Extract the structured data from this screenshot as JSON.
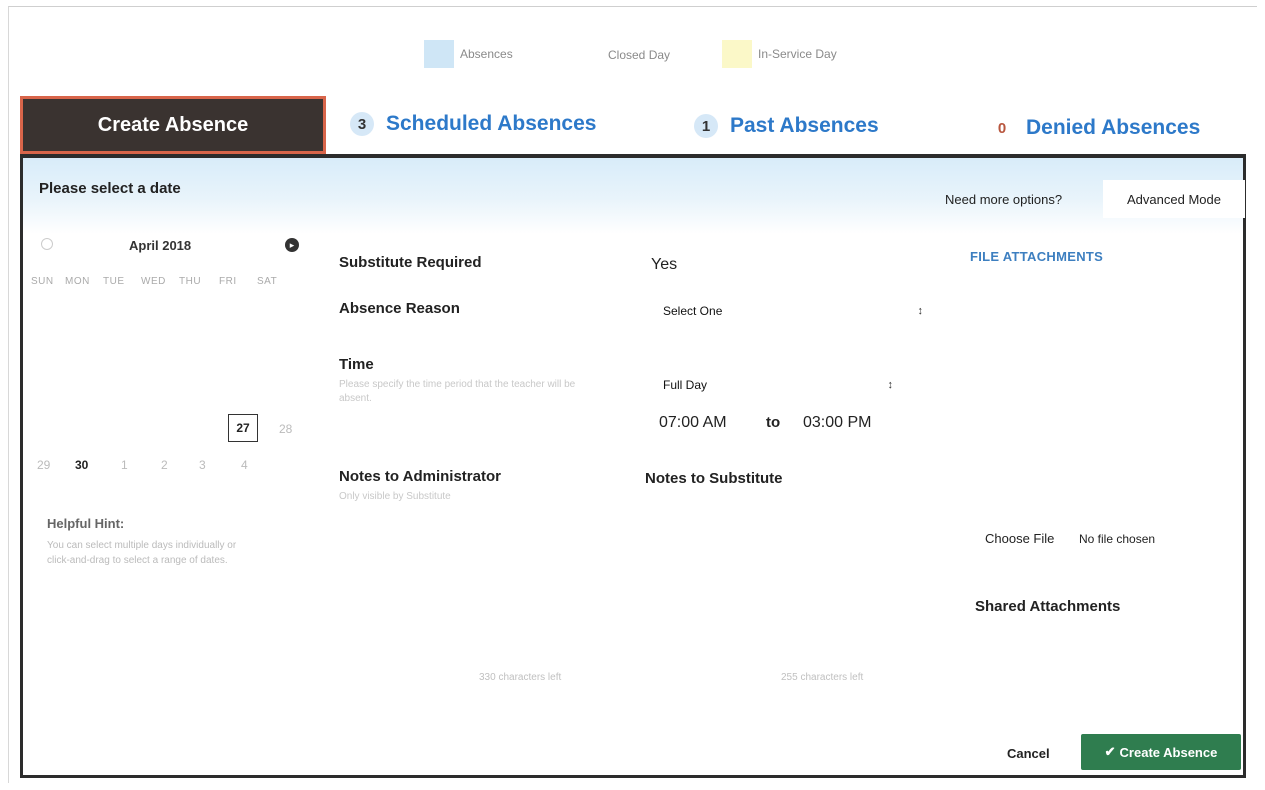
{
  "legend": {
    "absences": "Absences",
    "closed_day": "Closed Day",
    "in_service_day": "In-Service Day",
    "colors": {
      "absences": "#cfe6f6",
      "in_service_day": "#fbf8c8"
    }
  },
  "tabs": {
    "create": "Create Absence",
    "scheduled": {
      "count": "3",
      "label": "Scheduled Absences"
    },
    "past": {
      "count": "1",
      "label": "Past Absences"
    },
    "denied": {
      "count": "0",
      "label": "Denied Absences"
    }
  },
  "header": {
    "title": "Please select a date",
    "need_more": "Need more options?",
    "advanced_mode": "Advanced Mode"
  },
  "calendar": {
    "month": "April 2018",
    "next_icon": "chevron-right-icon",
    "weekdays": [
      "SUN",
      "MON",
      "TUE",
      "WED",
      "THU",
      "FRI",
      "SAT"
    ],
    "selected_day": "27",
    "day_28": "28",
    "day_29": "29",
    "day_30": "30",
    "may_days": [
      "1",
      "2",
      "3",
      "4"
    ]
  },
  "hint": {
    "title": "Helpful Hint:",
    "text": "You can select multiple days individually or click-and-drag to select a range of dates."
  },
  "form": {
    "substitute_required_label": "Substitute Required",
    "substitute_required_value": "Yes",
    "absence_reason_label": "Absence Reason",
    "absence_reason_value": "Select One",
    "time_label": "Time",
    "time_sublabel": "Please specify the time period that the teacher will be absent.",
    "time_value": "Full Day",
    "start_time": "07:00 AM",
    "to": "to",
    "end_time": "03:00 PM",
    "notes_admin_label": "Notes to Administrator",
    "notes_admin_sublabel": "Only visible by Substitute",
    "notes_sub_label": "Notes to Substitute",
    "notes_admin_count": "330 characters left",
    "notes_sub_count": "255 characters left"
  },
  "attachments": {
    "title": "FILE ATTACHMENTS",
    "choose_file": "Choose File",
    "no_file": "No file chosen",
    "shared": "Shared Attachments"
  },
  "actions": {
    "cancel": "Cancel",
    "create": "Create Absence",
    "accent_color": "#2f7d4f"
  }
}
